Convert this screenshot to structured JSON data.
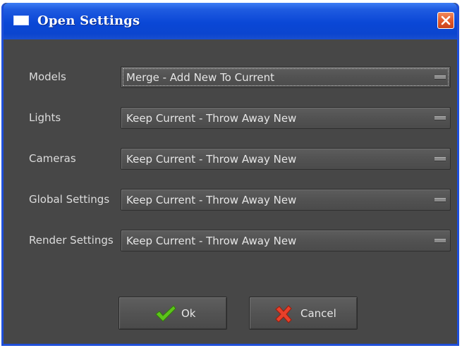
{
  "window": {
    "title": "Open Settings",
    "title_icon": "window-icon",
    "close_icon": "close-icon"
  },
  "settings": [
    {
      "label": "Models",
      "value": "Merge - Add New To Current"
    },
    {
      "label": "Lights",
      "value": "Keep Current - Throw Away New"
    },
    {
      "label": "Cameras",
      "value": "Keep Current - Throw Away New"
    },
    {
      "label": "Global Settings",
      "value": "Keep Current - Throw Away New"
    },
    {
      "label": "Render Settings",
      "value": "Keep Current - Throw Away New"
    }
  ],
  "buttons": {
    "ok": {
      "label": "Ok",
      "icon": "checkmark-icon",
      "color": "#5cc41a"
    },
    "cancel": {
      "label": "Cancel",
      "icon": "x-mark-icon",
      "color": "#e8402a"
    }
  },
  "colors": {
    "titlebar": "#0a47d6",
    "dialog_bg": "#474747"
  }
}
